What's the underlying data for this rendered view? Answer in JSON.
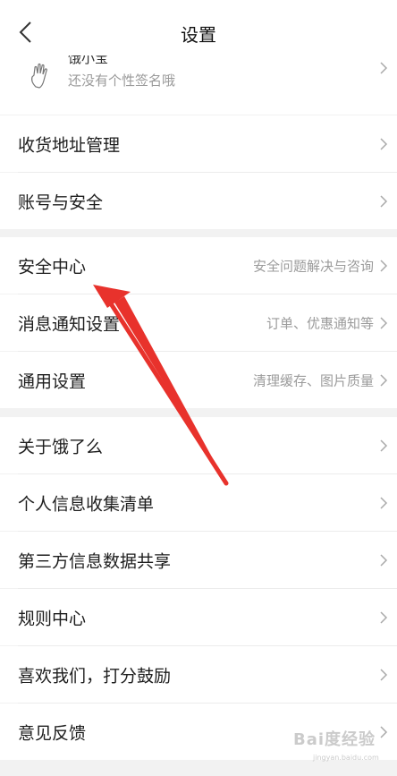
{
  "header": {
    "title": "设置",
    "back_icon": "chevron-left-icon"
  },
  "profile": {
    "name": "饿小宝",
    "signature": "还没有个性签名哦",
    "icon": "hand-icon"
  },
  "groups": [
    {
      "items": [
        {
          "label": "收货地址管理",
          "sub": ""
        },
        {
          "label": "账号与安全",
          "sub": ""
        }
      ]
    },
    {
      "items": [
        {
          "label": "安全中心",
          "sub": "安全问题解决与咨询"
        },
        {
          "label": "消息通知设置",
          "sub": "订单、优惠通知等"
        },
        {
          "label": "通用设置",
          "sub": "清理缓存、图片质量"
        }
      ]
    },
    {
      "items": [
        {
          "label": "关于饿了么",
          "sub": ""
        },
        {
          "label": "个人信息收集清单",
          "sub": ""
        },
        {
          "label": "第三方信息数据共享",
          "sub": ""
        },
        {
          "label": "规则中心",
          "sub": ""
        },
        {
          "label": "喜欢我们，打分鼓励",
          "sub": ""
        },
        {
          "label": "意见反馈",
          "sub": ""
        }
      ]
    }
  ],
  "annotation": {
    "arrow_color": "#e8322c",
    "icon": "red-arrow"
  },
  "watermark": {
    "text": "Bai度经验",
    "sub": "jingyan.baidu.com"
  },
  "colors": {
    "background": "#f2f2f2",
    "row": "#ffffff",
    "subtext": "#9b9b9b"
  }
}
